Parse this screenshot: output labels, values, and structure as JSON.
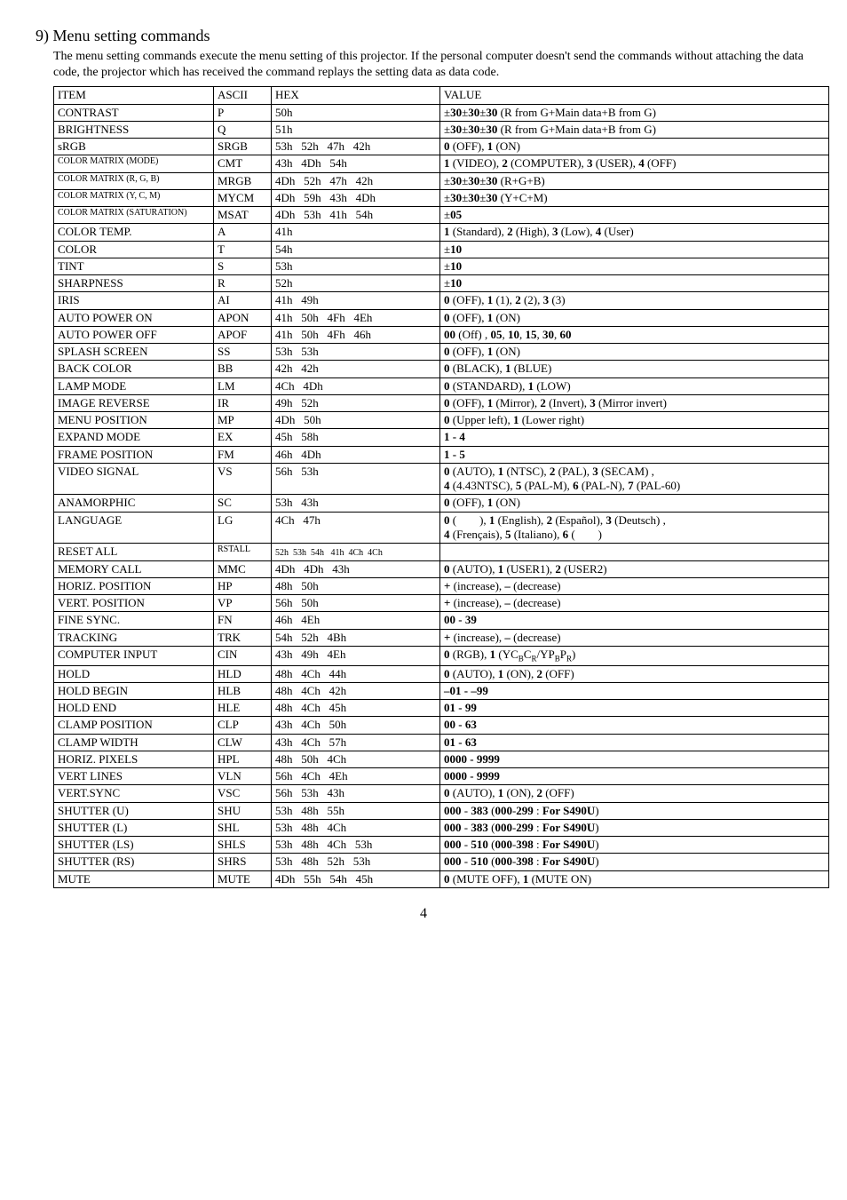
{
  "heading": "9) Menu setting commands",
  "intro": "The menu setting commands execute the menu setting of this projector. If the personal computer doesn't send the commands without attaching the data code, the projector which has received the command replays the setting data as data code.",
  "headers": {
    "item": "ITEM",
    "ascii": "ASCII",
    "hex": "HEX",
    "value": "VALUE"
  },
  "rows": [
    {
      "item": "CONTRAST",
      "ascii": "P",
      "hex": "50h",
      "value": "±<b>30</b>±<b>30</b>±<b>30</b> (R from G+Main data+B from G)"
    },
    {
      "item": "BRIGHTNESS",
      "ascii": "Q",
      "hex": "51h",
      "value": "±<b>30</b>±<b>30</b>±<b>30</b> (R from G+Main data+B from G)"
    },
    {
      "item": "sRGB",
      "ascii": "SRGB",
      "hex": "53h&nbsp;&nbsp;&nbsp;52h&nbsp;&nbsp;&nbsp;47h&nbsp;&nbsp;&nbsp;42h",
      "value": "<b>0</b> (OFF), <b>1</b> (ON)"
    },
    {
      "item": "COLOR MATRIX (MODE)",
      "itemClass": "sm",
      "ascii": "CMT",
      "hex": "43h&nbsp;&nbsp;&nbsp;4Dh&nbsp;&nbsp;&nbsp;54h",
      "value": "<b>1</b> (VIDEO), <b>2</b> (COMPUTER), <b>3</b> (USER), <b>4</b> (OFF)"
    },
    {
      "item": "COLOR MATRIX (R, G, B)",
      "itemClass": "sm",
      "ascii": "MRGB",
      "hex": "4Dh&nbsp;&nbsp;&nbsp;52h&nbsp;&nbsp;&nbsp;47h&nbsp;&nbsp;&nbsp;42h",
      "value": "±<b>30</b>±<b>30</b>±<b>30</b>  (R+G+B)"
    },
    {
      "item": "COLOR MATRIX (Y, C, M)",
      "itemClass": "sm",
      "ascii": "MYCM",
      "hex": "4Dh&nbsp;&nbsp;&nbsp;59h&nbsp;&nbsp;&nbsp;43h&nbsp;&nbsp;&nbsp;4Dh",
      "value": "±<b>30</b>±<b>30</b>±<b>30</b>  (Y+C+M)"
    },
    {
      "item": "COLOR MATRIX (SATURATION)",
      "itemClass": "sm",
      "ascii": "MSAT",
      "hex": "4Dh&nbsp;&nbsp;&nbsp;53h&nbsp;&nbsp;&nbsp;41h&nbsp;&nbsp;&nbsp;54h",
      "value": "±<b>05</b>"
    },
    {
      "item": "COLOR TEMP.",
      "ascii": "A",
      "hex": "41h",
      "value": "<b>1</b> (Standard), <b>2</b> (High), <b>3</b> (Low), <b>4</b> (User)"
    },
    {
      "item": "COLOR",
      "ascii": "T",
      "hex": "54h",
      "value": "±<b>10</b>"
    },
    {
      "item": "TINT",
      "ascii": "S",
      "hex": "53h",
      "value": "±<b>10</b>"
    },
    {
      "item": "SHARPNESS",
      "ascii": "R",
      "hex": "52h",
      "value": "±<b>10</b>"
    },
    {
      "item": "IRIS",
      "ascii": "AI",
      "hex": "41h&nbsp;&nbsp;&nbsp;49h",
      "value": "<b>0</b> (OFF), <b>1</b> (1), <b>2</b> (2), <b>3</b> (3)"
    },
    {
      "item": "AUTO POWER ON",
      "ascii": "APON",
      "hex": "41h&nbsp;&nbsp;&nbsp;50h&nbsp;&nbsp;&nbsp;4Fh&nbsp;&nbsp;&nbsp;4Eh",
      "value": "<b>0</b> (OFF), <b>1</b> (ON)"
    },
    {
      "item": "AUTO POWER OFF",
      "ascii": "APOF",
      "hex": "41h&nbsp;&nbsp;&nbsp;50h&nbsp;&nbsp;&nbsp;4Fh&nbsp;&nbsp;&nbsp;46h",
      "value": "<b>00</b> (Off) , <b>05</b>, <b>10</b>, <b>15</b>, <b>30</b>, <b>60</b>"
    },
    {
      "item": "SPLASH SCREEN",
      "ascii": "SS",
      "hex": "53h&nbsp;&nbsp;&nbsp;53h",
      "value": "<b>0</b> (OFF), <b>1</b> (ON)"
    },
    {
      "item": "BACK COLOR",
      "ascii": "BB",
      "hex": "42h&nbsp;&nbsp;&nbsp;42h",
      "value": "<b>0</b> (BLACK), <b>1</b> (BLUE)"
    },
    {
      "item": "LAMP MODE",
      "ascii": "LM",
      "hex": "4Ch&nbsp;&nbsp;&nbsp;4Dh",
      "value": "<b>0</b> (STANDARD), <b>1</b> (LOW)"
    },
    {
      "item": "IMAGE REVERSE",
      "ascii": "IR",
      "hex": "49h&nbsp;&nbsp;&nbsp;52h",
      "value": "<b>0</b> (OFF), <b>1</b> (Mirror), <b>2</b> (Invert), <b>3</b> (Mirror invert)"
    },
    {
      "item": "MENU POSITION",
      "ascii": "MP",
      "hex": "4Dh&nbsp;&nbsp;&nbsp;50h",
      "value": "<b>0</b> (Upper left), <b>1</b> (Lower right)"
    },
    {
      "item": "EXPAND MODE",
      "ascii": "EX",
      "hex": "45h&nbsp;&nbsp;&nbsp;58h",
      "value": "<b>1 - 4</b>"
    },
    {
      "item": "FRAME POSITION",
      "ascii": "FM",
      "hex": "46h&nbsp;&nbsp;&nbsp;4Dh",
      "value": "<b>1 - 5</b>"
    },
    {
      "item": "VIDEO SIGNAL",
      "ascii": "VS",
      "hex": "56h&nbsp;&nbsp;&nbsp;53h",
      "value": "<b>0</b> (AUTO), <b>1</b> (NTSC), <b>2</b> (PAL), <b>3</b> (SECAM) ,<br><b>4</b> (4.43NTSC),  <b>5</b> (PAL-M), <b>6</b> (PAL-N), <b>7</b> (PAL-60)"
    },
    {
      "item": "ANAMORPHIC",
      "ascii": "SC",
      "hex": "53h&nbsp;&nbsp;&nbsp;43h",
      "value": "<b>0</b> (OFF), <b>1</b> (ON)"
    },
    {
      "item": "LANGUAGE",
      "ascii": "LG",
      "hex": "4Ch&nbsp;&nbsp;&nbsp;47h",
      "value": "<b>0</b> (&nbsp;&nbsp;&nbsp;&nbsp;&nbsp;&nbsp;&nbsp;&nbsp;), <b>1</b> (English), <b>2</b> (Español), <b>3</b> (Deutsch) ,<br><b>4</b> (Frençais),  <b>5</b> (Italiano), <b>6</b> (&nbsp;&nbsp;&nbsp;&nbsp;&nbsp;&nbsp;&nbsp;&nbsp;)"
    },
    {
      "item": "RESET ALL",
      "ascii": "RSTALL",
      "asciiClass": "sm",
      "hex": "<span class='sm'>52h&nbsp;&nbsp;53h&nbsp;&nbsp;54h&nbsp;&nbsp;&nbsp;41h&nbsp;&nbsp;4Ch&nbsp;&nbsp;4Ch</span>",
      "value": ""
    },
    {
      "item": "MEMORY CALL",
      "ascii": "MMC",
      "hex": "4Dh&nbsp;&nbsp;&nbsp;4Dh&nbsp;&nbsp;&nbsp;43h",
      "value": "<b>0</b> (AUTO), <b>1</b> (USER1), <b>2</b> (USER2)"
    },
    {
      "item": "HORIZ. POSITION",
      "ascii": "HP",
      "hex": "48h&nbsp;&nbsp;&nbsp;50h",
      "value": "<b>+</b> (increase), <b>–</b> (decrease)"
    },
    {
      "item": "VERT. POSITION",
      "ascii": "VP",
      "hex": "56h&nbsp;&nbsp;&nbsp;50h",
      "value": "<b>+</b> (increase), <b>–</b> (decrease)"
    },
    {
      "item": "FINE SYNC.",
      "ascii": "FN",
      "hex": "46h&nbsp;&nbsp;&nbsp;4Eh",
      "value": "<b>00 - 39</b>"
    },
    {
      "item": "TRACKING",
      "ascii": "TRK",
      "hex": "54h&nbsp;&nbsp;&nbsp;52h&nbsp;&nbsp;&nbsp;4Bh",
      "value": "<b>+</b> (increase), <b>–</b> (decrease)"
    },
    {
      "item": "COMPUTER INPUT",
      "ascii": "CIN",
      "hex": "43h&nbsp;&nbsp;&nbsp;49h&nbsp;&nbsp;&nbsp;4Eh",
      "value": "<b>0</b> (RGB), <b>1</b> (YC<span class='sub'>B</span>C<span class='sub'>R</span>/YP<span class='sub'>B</span>P<span class='sub'>R</span>)"
    },
    {
      "item": "HOLD",
      "ascii": "HLD",
      "hex": "48h&nbsp;&nbsp;&nbsp;4Ch&nbsp;&nbsp;&nbsp;44h",
      "value": "<b>0</b> (AUTO), <b>1</b> (ON), <b>2</b> (OFF)"
    },
    {
      "item": "HOLD BEGIN",
      "ascii": "HLB",
      "hex": "48h&nbsp;&nbsp;&nbsp;4Ch&nbsp;&nbsp;&nbsp;42h",
      "value": "<b>–01 - –99</b>"
    },
    {
      "item": "HOLD END",
      "ascii": "HLE",
      "hex": "48h&nbsp;&nbsp;&nbsp;4Ch&nbsp;&nbsp;&nbsp;45h",
      "value": "<b>01 - 99</b>"
    },
    {
      "item": "CLAMP POSITION",
      "ascii": "CLP",
      "hex": "43h&nbsp;&nbsp;&nbsp;4Ch&nbsp;&nbsp;&nbsp;50h",
      "value": "<b>00 - 63</b>"
    },
    {
      "item": "CLAMP WIDTH",
      "ascii": "CLW",
      "hex": "43h&nbsp;&nbsp;&nbsp;4Ch&nbsp;&nbsp;&nbsp;57h",
      "value": "<b>01 - 63</b>"
    },
    {
      "item": "HORIZ. PIXELS",
      "ascii": "HPL",
      "hex": "48h&nbsp;&nbsp;&nbsp;50h&nbsp;&nbsp;&nbsp;4Ch",
      "value": "<b>0000 - 9999</b>"
    },
    {
      "item": "VERT LINES",
      "ascii": "VLN",
      "hex": "56h&nbsp;&nbsp;&nbsp;4Ch&nbsp;&nbsp;&nbsp;4Eh",
      "value": "<b>0000 - 9999</b>"
    },
    {
      "item": "VERT.SYNC",
      "ascii": "VSC",
      "hex": "56h&nbsp;&nbsp;&nbsp;53h&nbsp;&nbsp;&nbsp;43h",
      "value": "<b>0</b> (AUTO), <b>1</b> (ON), <b>2</b> (OFF)"
    },
    {
      "item": "SHUTTER (U)",
      "ascii": "SHU",
      "hex": "53h&nbsp;&nbsp;&nbsp;48h&nbsp;&nbsp;&nbsp;55h",
      "value": "<b>000</b> - <b>383</b> (<b>000</b>-<b>299</b> : <b>For S490U</b>)"
    },
    {
      "item": "SHUTTER (L)",
      "ascii": "SHL",
      "hex": "53h&nbsp;&nbsp;&nbsp;48h&nbsp;&nbsp;&nbsp;4Ch",
      "value": "<b>000</b> - <b>383</b> (<b>000</b>-<b>299</b> : <b>For S490U</b>)"
    },
    {
      "item": "SHUTTER (LS)",
      "ascii": "SHLS",
      "hex": "53h&nbsp;&nbsp;&nbsp;48h&nbsp;&nbsp;&nbsp;4Ch&nbsp;&nbsp;&nbsp;53h",
      "value": "<b>000</b> - <b>510</b> (<b>000</b>-<b>398</b> : <b>For S490U</b>)"
    },
    {
      "item": "SHUTTER (RS)",
      "ascii": "SHRS",
      "hex": "53h&nbsp;&nbsp;&nbsp;48h&nbsp;&nbsp;&nbsp;52h&nbsp;&nbsp;&nbsp;53h",
      "value": "<b>000</b> - <b>510</b> (<b>000</b>-<b>398</b> : <b>For S490U</b>)"
    },
    {
      "item": "MUTE",
      "ascii": "MUTE",
      "hex": "4Dh&nbsp;&nbsp;&nbsp;55h&nbsp;&nbsp;&nbsp;54h&nbsp;&nbsp;&nbsp;45h",
      "value": "<b>0</b> (MUTE OFF), <b>1</b> (MUTE ON)"
    }
  ],
  "page": "4"
}
